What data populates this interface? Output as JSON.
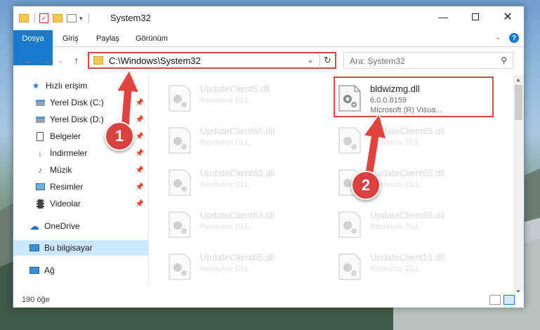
{
  "window": {
    "title": "System32"
  },
  "ribbon": {
    "tabs": [
      "Dosya",
      "Giriş",
      "Paylaş",
      "Görünüm"
    ]
  },
  "address": {
    "path": "C:\\Windows\\System32"
  },
  "search": {
    "placeholder": "Ara: System32"
  },
  "sidebar": {
    "items": [
      {
        "label": "Hızlı erişim",
        "icon": "star-icon"
      },
      {
        "label": "Yerel Disk (C:)",
        "icon": "drive-icon",
        "pinned": true
      },
      {
        "label": "Yerel Disk (D:)",
        "icon": "drive-icon",
        "pinned": true
      },
      {
        "label": "Belgeler",
        "icon": "document-icon",
        "pinned": true
      },
      {
        "label": "İndirmeler",
        "icon": "download-icon",
        "pinned": true
      },
      {
        "label": "Müzik",
        "icon": "music-icon",
        "pinned": true
      },
      {
        "label": "Resimler",
        "icon": "pictures-icon",
        "pinned": true
      },
      {
        "label": "Videolar",
        "icon": "video-icon",
        "pinned": true
      },
      {
        "label": "OneDrive",
        "icon": "cloud-icon"
      },
      {
        "label": "Bu bilgisayar",
        "icon": "computer-icon",
        "selected": true
      },
      {
        "label": "Ağ",
        "icon": "network-icon"
      }
    ]
  },
  "files": [
    {
      "name": "UpdateClient5.dll",
      "type": "Resource DLL"
    },
    {
      "name": "bldwizmg.dll",
      "type": "6.0.0.8159",
      "desc": "Microsoft (R) Visua...",
      "highlighted": true
    },
    {
      "name": "UpdateClient65.dll",
      "type": "Resource DLL"
    },
    {
      "name": "UpdateClient65.dll",
      "type": "Resource DLL"
    },
    {
      "name": "UpdateClient63.dll",
      "type": "Resource DLL"
    },
    {
      "name": "UpdateClient65.dll",
      "type": "Resource DLL"
    },
    {
      "name": "UpdateClient63.dll",
      "type": "Resource DLL"
    },
    {
      "name": "UpdateClient65.dll",
      "type": "Resource DLL"
    },
    {
      "name": "UpdateClient65.dll",
      "type": "Resource DLL"
    },
    {
      "name": "UpdateClient21.dll",
      "type": "Resource DLL"
    }
  ],
  "status": {
    "count": "190 öğe"
  },
  "annotations": {
    "badge1": "1",
    "badge2": "2"
  },
  "colors": {
    "accent": "#1979ca",
    "highlight": "#e0443e",
    "selection": "#cce8ff"
  }
}
